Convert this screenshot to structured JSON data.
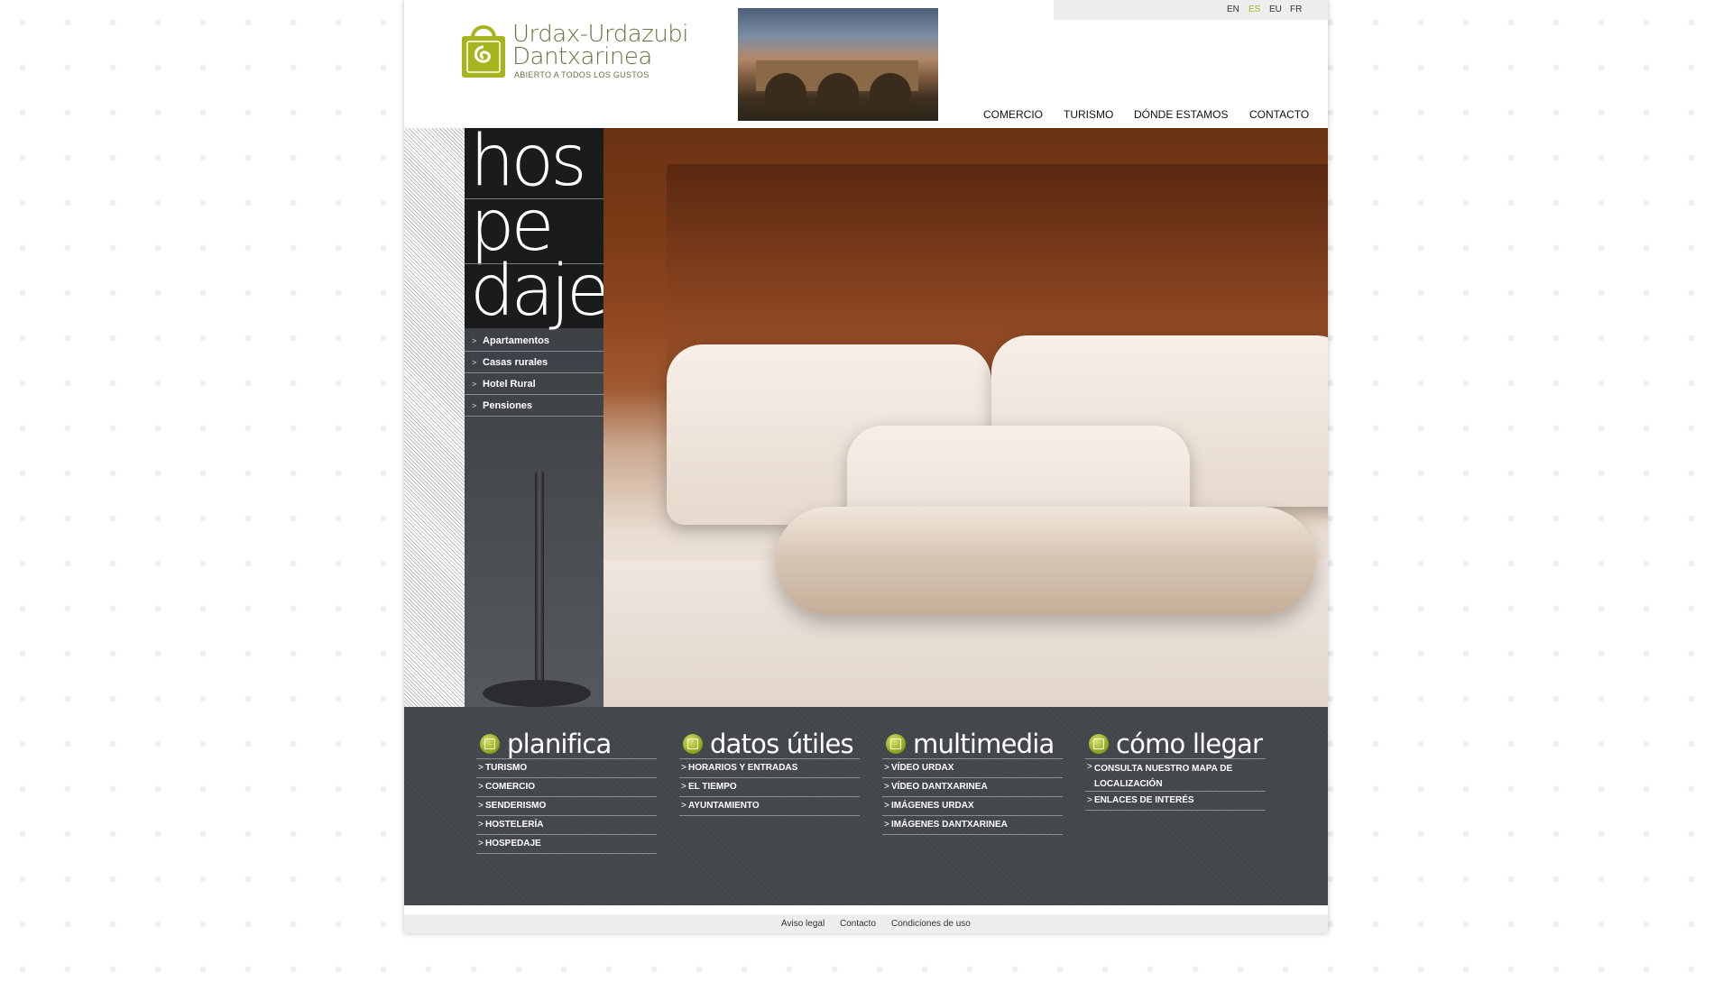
{
  "brand": {
    "title_line1": "Urdax-Urdazubi",
    "title_line2": "Dantxarinea",
    "tagline": "ABIERTO A TODOS LOS GUSTOS",
    "accent_color": "#a6b41e"
  },
  "languages": [
    {
      "code": "EN",
      "active": false
    },
    {
      "code": "ES",
      "active": true
    },
    {
      "code": "EU",
      "active": false
    },
    {
      "code": "FR",
      "active": false
    }
  ],
  "top_nav": [
    "COMERCIO",
    "TURISMO",
    "DÓNDE ESTAMOS",
    "CONTACTO"
  ],
  "section": {
    "title_lines": [
      "hos",
      "pe",
      "daje"
    ],
    "submenu": [
      "Apartamentos",
      "Casas rurales",
      "Hotel Rural",
      "Pensiones"
    ],
    "arrow": ">"
  },
  "footer_columns": [
    {
      "title": "planifica",
      "icon": "calendar-icon",
      "links": [
        "TURISMO",
        "COMERCIO",
        "SENDERISMO",
        "HOSTELERÍA",
        "HOSPEDAJE"
      ]
    },
    {
      "title": "datos útiles",
      "icon": "info-icon",
      "links": [
        "HORARIOS Y ENTRADAS",
        "EL TIEMPO",
        "AYUNTAMIENTO"
      ]
    },
    {
      "title": "multimedia",
      "icon": "eye-icon",
      "links": [
        "VÍDEO URDAX",
        "VÍDEO DANTXARINEA",
        "IMÁGENES URDAX",
        "IMÁGENES DANTXARINEA"
      ]
    },
    {
      "title": "cómo llegar",
      "icon": "car-icon",
      "links": [
        "CONSULTA NUESTRO MAPA DE LOCALIZACIÓN",
        "ENLACES DE INTERÉS"
      ]
    }
  ],
  "bottom_links": [
    "Aviso legal",
    "Contacto",
    "Condiciones de uso"
  ]
}
